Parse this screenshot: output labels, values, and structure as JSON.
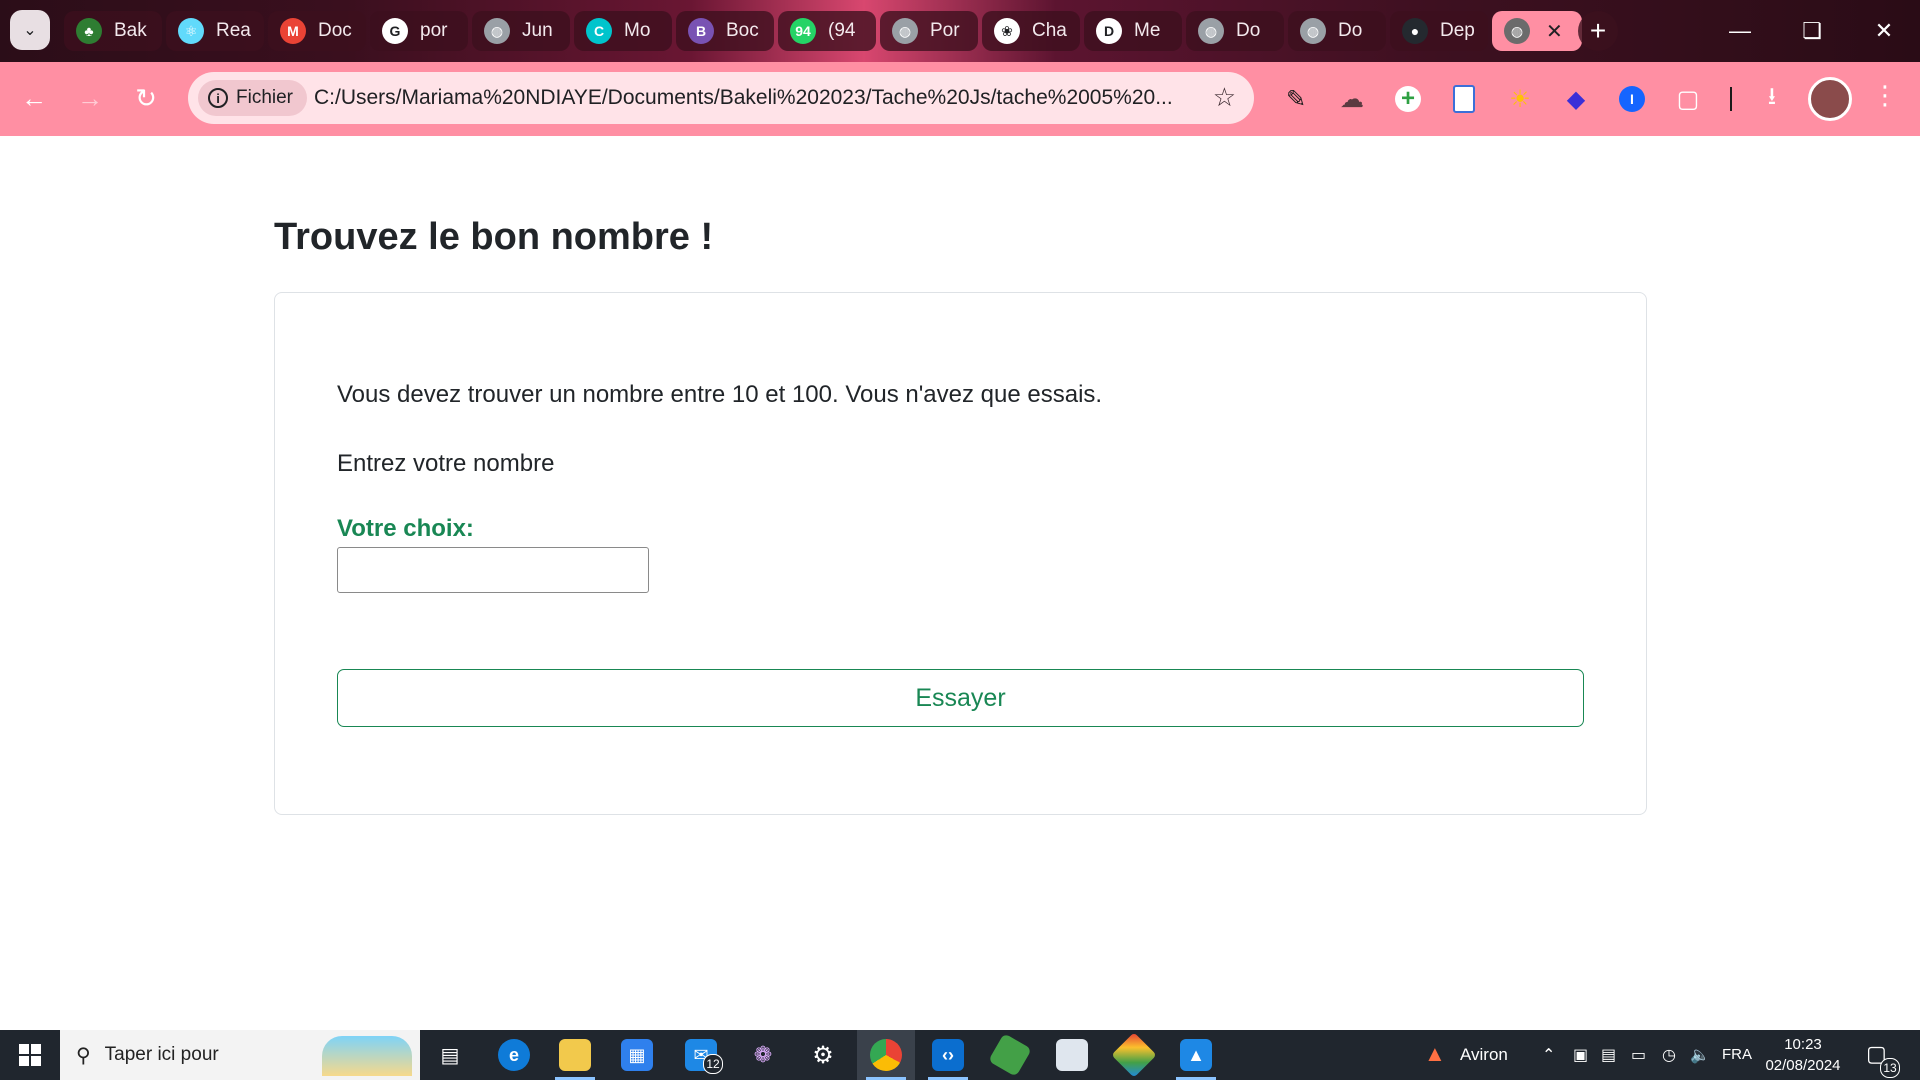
{
  "browser": {
    "tabs": [
      {
        "label": "Bak",
        "icon": "bakeli-icon",
        "color": "#2e7d32"
      },
      {
        "label": "Rea",
        "icon": "react-icon",
        "color": "#61dafb"
      },
      {
        "label": "Doc",
        "icon": "gmail-icon",
        "color": "#ea4335"
      },
      {
        "label": "por",
        "icon": "google-icon",
        "color": "#ffffff"
      },
      {
        "label": "Jun",
        "icon": "globe-icon",
        "color": "#9aa0a6"
      },
      {
        "label": "Mo",
        "icon": "canva-icon",
        "color": "#00c4cc"
      },
      {
        "label": "Boc",
        "icon": "bootstrap-icon",
        "color": "#7952b3"
      },
      {
        "label": "(94",
        "icon": "whatsapp-icon",
        "color": "#25d366"
      },
      {
        "label": "Por",
        "icon": "globe-icon",
        "color": "#9aa0a6"
      },
      {
        "label": "Cha",
        "icon": "chatgpt-icon",
        "color": "#ffffff"
      },
      {
        "label": "Me",
        "icon": "deke-icon",
        "color": "#ffffff"
      },
      {
        "label": "Do",
        "icon": "globe-icon",
        "color": "#9aa0a6"
      },
      {
        "label": "Do",
        "icon": "globe-icon",
        "color": "#9aa0a6"
      },
      {
        "label": "Dep",
        "icon": "github-icon",
        "color": "#24292f"
      }
    ],
    "active_tab_close": "✕",
    "new_tab": "+",
    "chip_label": "Fichier",
    "url": "C:/Users/Mariama%20NDIAYE/Documents/Bakeli%202023/Tache%20Js/tache%2005%20...",
    "accent_color": "#ff8fa3"
  },
  "page": {
    "title": "Trouvez le bon nombre !",
    "instructions": "Vous devez trouver un nombre entre 10 et 100. Vous n'avez que essais.",
    "prompt": "Entrez votre nombre",
    "choice_label": "Votre choix:",
    "choice_value": "",
    "button_label": "Essayer",
    "accent_color": "#198754"
  },
  "taskbar": {
    "search_placeholder": "Taper ici pour",
    "mail_badge": "12",
    "weather_label": "Aviron",
    "language": "FRA",
    "time": "10:23",
    "date": "02/08/2024",
    "notifications_count": "13"
  }
}
